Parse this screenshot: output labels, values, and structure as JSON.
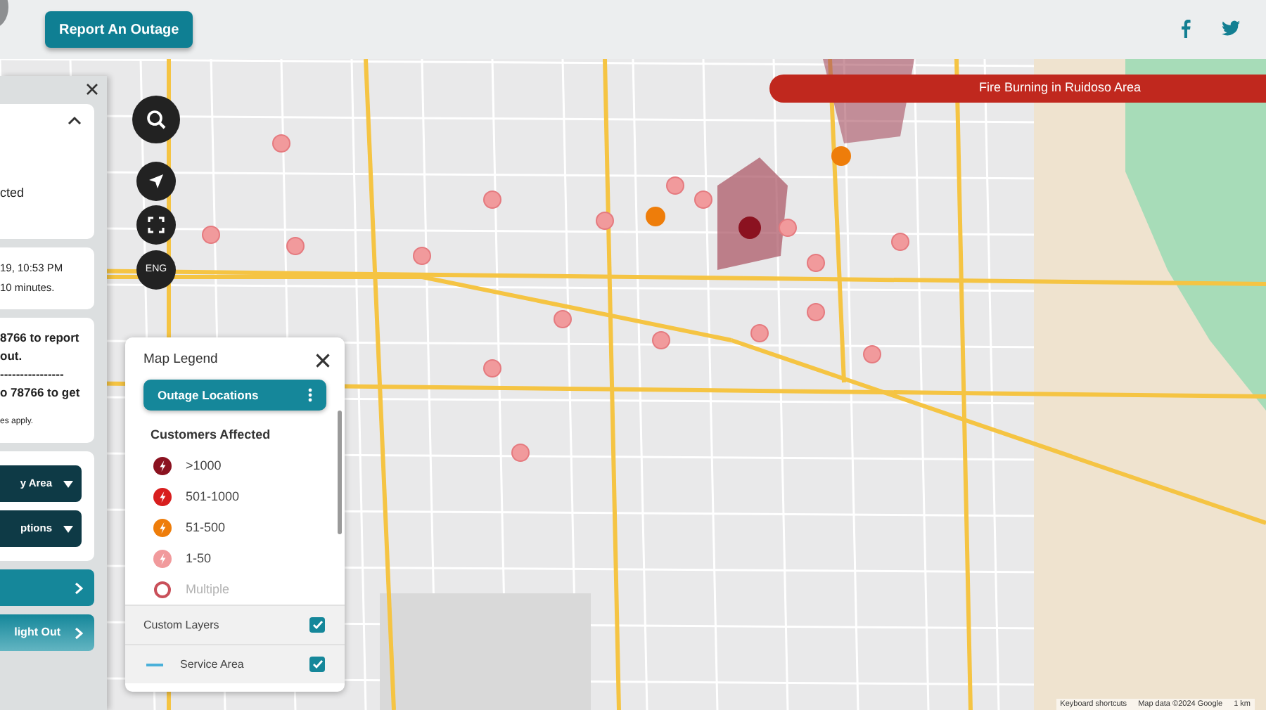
{
  "header": {
    "report_button": "Report An Outage",
    "social": [
      {
        "kind": "facebook"
      },
      {
        "kind": "twitter"
      }
    ]
  },
  "side_panel": {
    "summary": {
      "text": "cted",
      "expanded": true
    },
    "update": {
      "lines": [
        "19, 10:53 PM",
        "10 minutes."
      ]
    },
    "sms": {
      "lines": [
        "8766 to report",
        "out.",
        "----------------",
        "o 78766 to get"
      ],
      "note": "es apply."
    },
    "dropdowns": [
      "y Area",
      "ptions"
    ],
    "nav_buttons": [
      {
        "kind": "plain"
      },
      {
        "kind": "labeled",
        "label": "light Out"
      }
    ]
  },
  "map_controls": {
    "language": "ENG"
  },
  "banner": "Fire Burning in Ruidoso Area",
  "legend": {
    "title": "Map Legend",
    "layer_button": "Outage Locations",
    "section": "Customers Affected",
    "items": [
      {
        "label": ">1000",
        "color": "#8b1220",
        "kind": "solid"
      },
      {
        "label": "501-1000",
        "color": "#d81e1e",
        "kind": "solid"
      },
      {
        "label": "51-500",
        "color": "#ee7d0a",
        "kind": "solid"
      },
      {
        "label": "1-50",
        "color": "#f19a9c",
        "kind": "solid"
      },
      {
        "label": "Multiple",
        "color": "#c9505a",
        "kind": "ring"
      }
    ],
    "layers": [
      {
        "label": "Custom Layers",
        "checked": true,
        "kind": "group"
      },
      {
        "label": "Service Area",
        "checked": true,
        "kind": "line",
        "color": "#4ab0d9"
      }
    ]
  },
  "attribution": [
    "Keyboard shortcuts",
    "Map data ©2024 Google",
    "1 km"
  ]
}
